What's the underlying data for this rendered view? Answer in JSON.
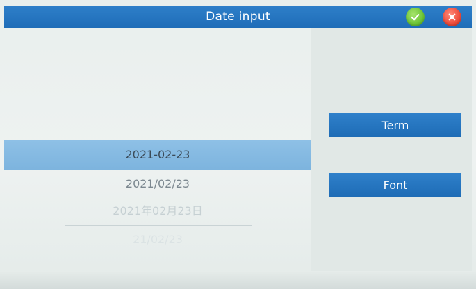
{
  "window": {
    "title": "Date input"
  },
  "toolbar": {
    "confirm_icon": "check-icon",
    "cancel_icon": "close-icon",
    "confirm_color": "#6cc436",
    "cancel_color": "#ec4a3a",
    "accent_color": "#1f6db8"
  },
  "date_formats": {
    "selected_index": 0,
    "options": [
      "2021-02-23",
      "2021/02/23",
      "2021年02月23日",
      "21/02/23"
    ]
  },
  "side_buttons": {
    "term_label": "Term",
    "font_label": "Font"
  }
}
